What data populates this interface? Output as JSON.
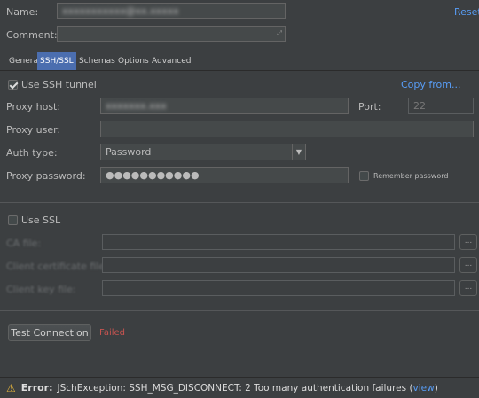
{
  "name": {
    "label": "Name:",
    "value": "xxxxxxxxxxx@xx.xxxxx"
  },
  "reset_label": "Reset",
  "comment": {
    "label": "Comment:",
    "value": ""
  },
  "tabs": [
    {
      "label": "General",
      "active": false
    },
    {
      "label": "SSH/SSL",
      "active": true
    },
    {
      "label": "Schemas",
      "active": false
    },
    {
      "label": "Options",
      "active": false
    },
    {
      "label": "Advanced",
      "active": false
    }
  ],
  "ssh": {
    "use_tunnel_label": "Use SSH tunnel",
    "use_tunnel_checked": true,
    "copy_from_label": "Copy from...",
    "proxy_host_label": "Proxy host:",
    "proxy_host_value": "xxxxxxx.xxx",
    "port_label": "Port:",
    "port_value": "22",
    "proxy_user_label": "Proxy user:",
    "proxy_user_value": "",
    "auth_type_label": "Auth type:",
    "auth_type_value": "Password",
    "proxy_password_label": "Proxy password:",
    "proxy_password_value": "●●●●●●●●●●●",
    "remember_password_label": "Remember password",
    "remember_password_checked": false
  },
  "ssl": {
    "use_ssl_label": "Use SSL",
    "use_ssl_checked": false,
    "ca_file_label": "CA file:",
    "client_cert_label": "Client certificate file:",
    "client_key_label": "Client key file:",
    "browse_label": "..."
  },
  "test": {
    "button_label": "Test Connection",
    "status": "Failed",
    "status_color": "#c75450"
  },
  "error": {
    "prefix": "Error:",
    "message": "JSchException: SSH_MSG_DISCONNECT: 2 Too many authentication failures (",
    "link": "view",
    "suffix": ")"
  },
  "colors": {
    "accent": "#589df6",
    "tab_active": "#4b6eaf",
    "background": "#3c3f41"
  }
}
